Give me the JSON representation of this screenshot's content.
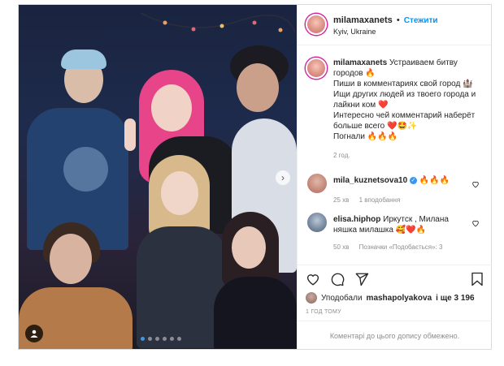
{
  "header": {
    "username": "milamaxanets",
    "separator": "•",
    "follow_label": "Стежити",
    "location": "Kyiv, Ukraine"
  },
  "caption": {
    "username": "milamaxanets",
    "line1": "Устраиваем битву городов 🔥",
    "line2": "Пиши в комментариях свой город 🏰",
    "line3": "Ищи других людей из твоего города и лайкни ком ❤️",
    "line4": "Интересно чей комментарий наберёт больше всего ❤️🤩✨",
    "line5": "Погнали 🔥🔥🔥",
    "time": "2 год."
  },
  "comments": [
    {
      "username": "mila_kuznetsova10",
      "text": "🔥🔥🔥",
      "time": "25 хв",
      "likes": "1 вподобання",
      "reply": ""
    },
    {
      "username": "elisa.hiphop",
      "text": "Иркутск , Милана няшка милашка 🥰❤️🔥",
      "time": "50 хв",
      "likes": "",
      "reply": "Позначки «Подобається»: 3"
    }
  ],
  "likes": {
    "prefix": "Уподобали",
    "user": "mashapolyakova",
    "suffix": "і ще 3 196"
  },
  "timestamp": "1 ГОД ТОМУ",
  "comments_limited": "Коментарі до цього допису обмежено.",
  "colors": {
    "accent": "#0095f6",
    "heart": "#ed4956",
    "text": "#262626",
    "muted": "#8e8e8e"
  },
  "icons": {
    "tag": "person-tag-icon",
    "next": "chevron-right-icon",
    "like": "heart-icon",
    "comment": "comment-icon",
    "share": "share-icon",
    "save": "bookmark-icon"
  },
  "carousel": {
    "total": 6,
    "active": 1
  }
}
